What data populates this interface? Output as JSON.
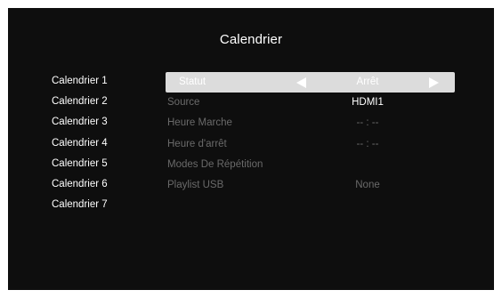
{
  "title": "Calendrier",
  "calendars": [
    "Calendrier 1",
    "Calendrier 2",
    "Calendrier 3",
    "Calendrier 4",
    "Calendrier 5",
    "Calendrier 6",
    "Calendrier 7"
  ],
  "settings": {
    "statut": {
      "label": "Statut",
      "value": "Arrêt",
      "prev_icon": "triangle-left-icon",
      "next_icon": "triangle-right-icon"
    },
    "source": {
      "label": "Source",
      "value": "HDMI1"
    },
    "heure_marche": {
      "label": "Heure Marche",
      "value": "-- : --"
    },
    "heure_arret": {
      "label": "Heure d'arrêt",
      "value": "-- : --"
    },
    "modes_repetition": {
      "label": "Modes De Répétition"
    },
    "playlist_usb": {
      "label": "Playlist USB",
      "value": "None"
    }
  },
  "colors": {
    "background": "#0e0e0e",
    "highlight": "#dcdcdc",
    "text": "#ffffff",
    "text_disabled": "#6a6a6a"
  }
}
